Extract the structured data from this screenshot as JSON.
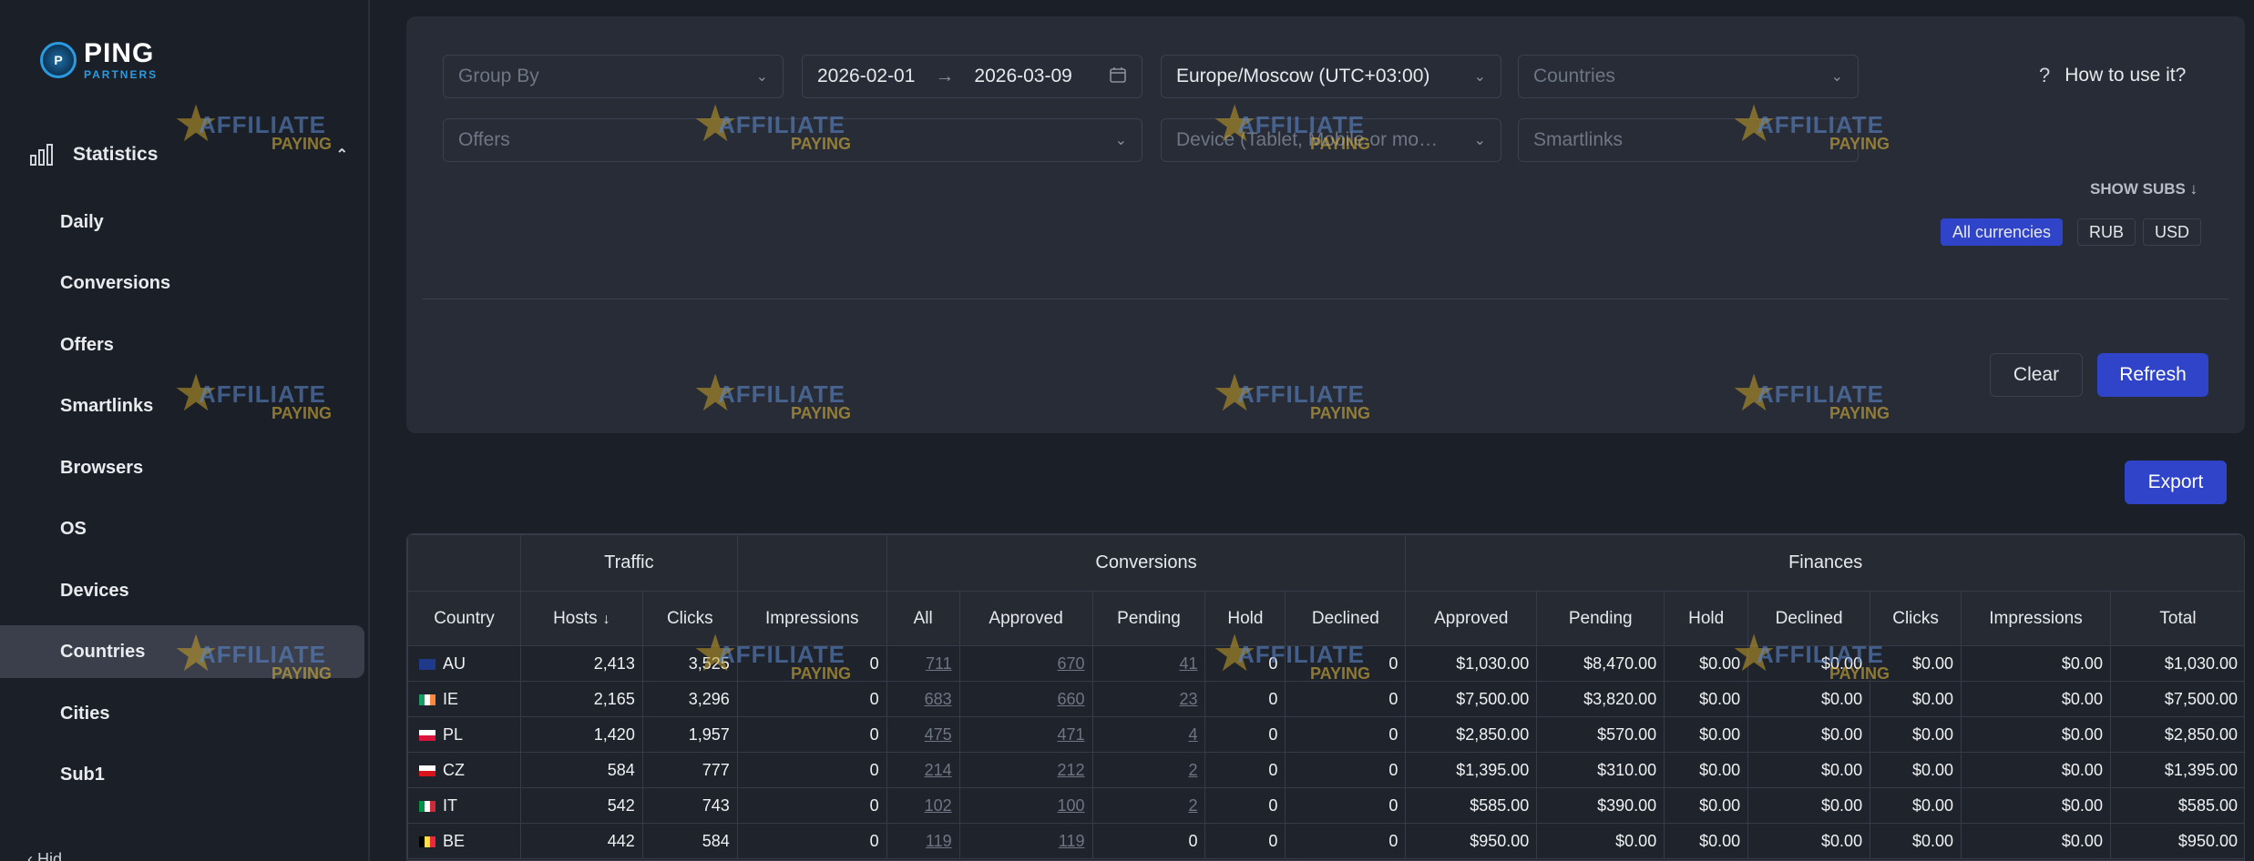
{
  "logo": {
    "line1": "PING",
    "line2": "PARTNERS",
    "mark": "P"
  },
  "sidebar": {
    "section_label": "Statistics",
    "items": [
      "Daily",
      "Conversions",
      "Offers",
      "Smartlinks",
      "Browsers",
      "OS",
      "Devices",
      "Countries",
      "Cities",
      "Sub1"
    ],
    "active": "Countries",
    "cut_item": "Hid"
  },
  "filters": {
    "group_by_placeholder": "Group By",
    "date_from": "2026-02-01",
    "date_to": "2026-03-09",
    "date_separator": "→",
    "timezone": "Europe/Moscow (UTC+03:00)",
    "countries_placeholder": "Countries",
    "offers_placeholder": "Offers",
    "devices_placeholder": "Device (Tablet, Mobile or mo…",
    "smartlinks_placeholder": "Smartlinks",
    "help_label": "How to use it?",
    "show_subs_label": "SHOW SUBS",
    "currencies": [
      "All currencies",
      "RUB",
      "USD"
    ],
    "active_currency": "All currencies",
    "clear_label": "Clear",
    "refresh_label": "Refresh"
  },
  "export_label": "Export",
  "watermark": {
    "line1": "AFFILIATE",
    "line2": "PAYING"
  },
  "table": {
    "groups": [
      {
        "label": "",
        "span": 1
      },
      {
        "label": "Traffic",
        "span": 2
      },
      {
        "label": "",
        "span": 1
      },
      {
        "label": "Conversions",
        "span": 5
      },
      {
        "label": "Finances",
        "span": 7
      }
    ],
    "columns": [
      "Country",
      "Hosts",
      "Clicks",
      "Impressions",
      "All",
      "Approved",
      "Pending",
      "Hold",
      "Declined",
      "Approved",
      "Pending",
      "Hold",
      "Declined",
      "Clicks",
      "Impressions",
      "Total"
    ],
    "sort_column": "Hosts",
    "rows": [
      {
        "flag": "AU",
        "country": "AU",
        "cells": [
          "2,413",
          "3,525",
          "0",
          "711",
          "670",
          "41",
          "0",
          "0",
          "$1,030.00",
          "$8,470.00",
          "$0.00",
          "$0.00",
          "$0.00",
          "$0.00",
          "$1,030.00"
        ]
      },
      {
        "flag": "IE",
        "country": "IE",
        "cells": [
          "2,165",
          "3,296",
          "0",
          "683",
          "660",
          "23",
          "0",
          "0",
          "$7,500.00",
          "$3,820.00",
          "$0.00",
          "$0.00",
          "$0.00",
          "$0.00",
          "$7,500.00"
        ]
      },
      {
        "flag": "PL",
        "country": "PL",
        "cells": [
          "1,420",
          "1,957",
          "0",
          "475",
          "471",
          "4",
          "0",
          "0",
          "$2,850.00",
          "$570.00",
          "$0.00",
          "$0.00",
          "$0.00",
          "$0.00",
          "$2,850.00"
        ]
      },
      {
        "flag": "CZ",
        "country": "CZ",
        "cells": [
          "584",
          "777",
          "0",
          "214",
          "212",
          "2",
          "0",
          "0",
          "$1,395.00",
          "$310.00",
          "$0.00",
          "$0.00",
          "$0.00",
          "$0.00",
          "$1,395.00"
        ]
      },
      {
        "flag": "IT",
        "country": "IT",
        "cells": [
          "542",
          "743",
          "0",
          "102",
          "100",
          "2",
          "0",
          "0",
          "$585.00",
          "$390.00",
          "$0.00",
          "$0.00",
          "$0.00",
          "$0.00",
          "$585.00"
        ]
      },
      {
        "flag": "BE",
        "country": "BE",
        "cells": [
          "442",
          "584",
          "0",
          "119",
          "119",
          "0",
          "0",
          "0",
          "$950.00",
          "$0.00",
          "$0.00",
          "$0.00",
          "$0.00",
          "$0.00",
          "$950.00"
        ]
      }
    ],
    "link_columns": [
      3,
      4,
      5
    ]
  }
}
